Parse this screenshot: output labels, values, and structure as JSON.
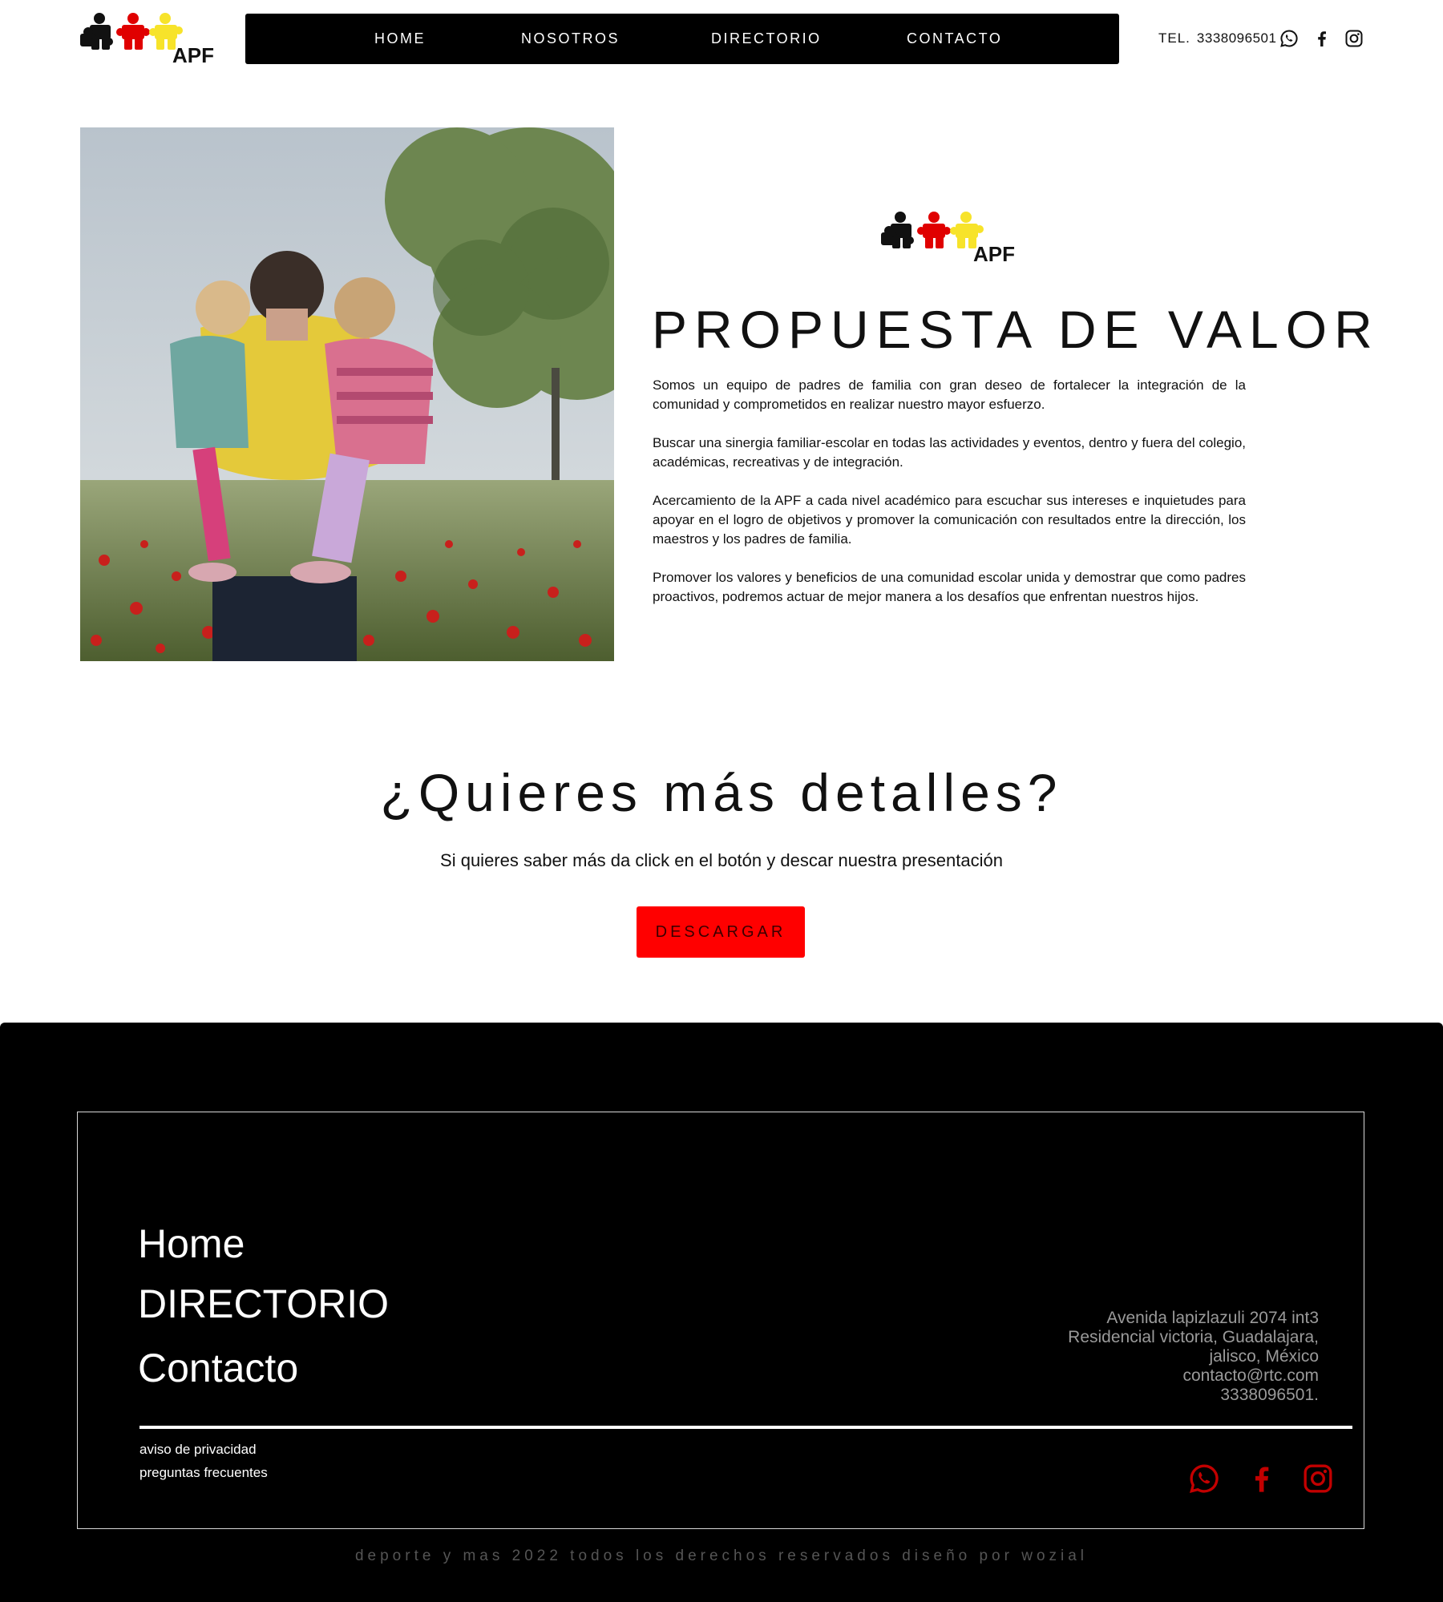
{
  "brand": {
    "logo_text": "APF"
  },
  "colors": {
    "accent": "#ff0000",
    "footer_bg": "#000000",
    "nav_bg": "#000000",
    "puzzle_black": "#111111",
    "puzzle_red": "#e00000",
    "puzzle_yellow": "#f7e32a"
  },
  "nav": {
    "items": [
      {
        "label": "HOME"
      },
      {
        "label": "NOSOTROS"
      },
      {
        "label": "DIRECTORIO"
      },
      {
        "label": "CONTACTO"
      }
    ]
  },
  "contact": {
    "tel_label": "TEL.",
    "tel_number": "3338096501",
    "icons": [
      "whatsapp-icon",
      "facebook-icon",
      "instagram-icon"
    ]
  },
  "hero": {
    "image": "parent-carrying-two-children-in-poppy-field",
    "title": "PROPUESTA DE VALOR",
    "paragraphs": [
      "Somos un equipo de padres de familia con gran deseo de fortalecer la integración de la comunidad y comprometidos en realizar nuestro mayor esfuerzo.",
      "Buscar una sinergia familiar-escolar en todas las actividades y eventos, dentro y fuera del colegio, académicas, recreativas y de integración.",
      "Acercamiento de la APF a cada nivel académico para escuchar sus intereses e inquietudes para apoyar en el logro de objetivos y promover la comunicación con resultados entre la dirección, los maestros y los padres de familia.",
      "Promover los valores y beneficios de una comunidad escolar unida y demostrar que como padres proactivos, podremos actuar de mejor manera a los desafíos que enfrentan nuestros hijos."
    ]
  },
  "cta": {
    "title": "¿Quieres más detalles?",
    "subtitle": "Si quieres saber más da click en el botón y descar nuestra presentación",
    "button_label": "DESCARGAR"
  },
  "footer": {
    "nav": [
      {
        "label": "Home"
      },
      {
        "label": "DIRECTORIO"
      },
      {
        "label": "Contacto"
      }
    ],
    "address_lines": [
      "Avenida lapizlazuli 2074 int3",
      "Residencial victoria, Guadalajara,",
      "jalisco, México",
      "contacto@rtc.com",
      "3338096501."
    ],
    "legal": [
      {
        "label": "aviso de privacidad"
      },
      {
        "label": "preguntas frecuentes"
      }
    ],
    "social_icons": [
      "whatsapp-icon",
      "facebook-icon",
      "instagram-icon"
    ],
    "copyright": "deporte y mas 2022 todos los derechos reservados diseño por wozial"
  }
}
